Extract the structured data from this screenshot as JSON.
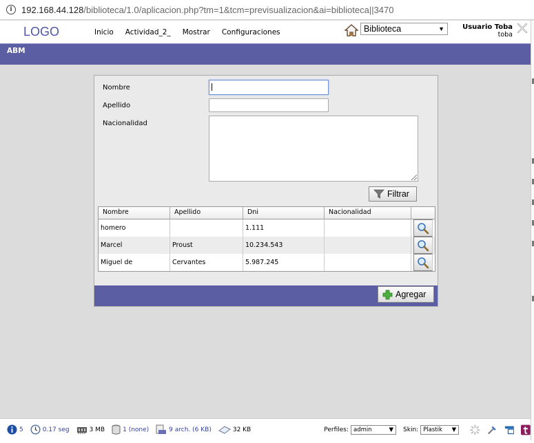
{
  "browser": {
    "url_host": "192.168.44.128",
    "url_path": "/biblioteca/1.0/aplicacion.php?tm=1&tcm=previsualizacion&ai=biblioteca||3470"
  },
  "header": {
    "logo": "LOGO",
    "menu": [
      "Inicio",
      "Actividad_2_",
      "Mostrar",
      "Configuraciones"
    ],
    "project_select": "Biblioteca",
    "user_name": "Usuario Toba",
    "user_login": "toba"
  },
  "title": "ABM",
  "form": {
    "nombre_label": "Nombre",
    "apellido_label": "Apellido",
    "nacionalidad_label": "Nacionalidad",
    "nombre_value": "",
    "apellido_value": "",
    "nacionalidad_value": "",
    "filter_button": "Filtrar"
  },
  "table": {
    "headers": [
      "Nombre",
      "Apellido",
      "Dni",
      "Nacionalidad"
    ],
    "rows": [
      {
        "nombre": "homero",
        "apellido": "",
        "dni": "1.111",
        "nacionalidad": ""
      },
      {
        "nombre": "Marcel",
        "apellido": "Proust",
        "dni": "10.234.543",
        "nacionalidad": ""
      },
      {
        "nombre": "Miguel de",
        "apellido": "Cervantes",
        "dni": "5.987.245",
        "nacionalidad": ""
      }
    ]
  },
  "add_button": "Agregar",
  "footer": {
    "info_count": "5",
    "time": "0.17 seg",
    "memory": "3 MB",
    "db": "1 (none)",
    "files": "9 arch. (6 KB)",
    "session": "32 KB",
    "perfiles_label": "Perfiles:",
    "perfiles_value": "admin",
    "skin_label": "Skin:",
    "skin_value": "Plastik"
  },
  "colors": {
    "accent": "#5b5ea2",
    "logo": "#4f56a8"
  }
}
